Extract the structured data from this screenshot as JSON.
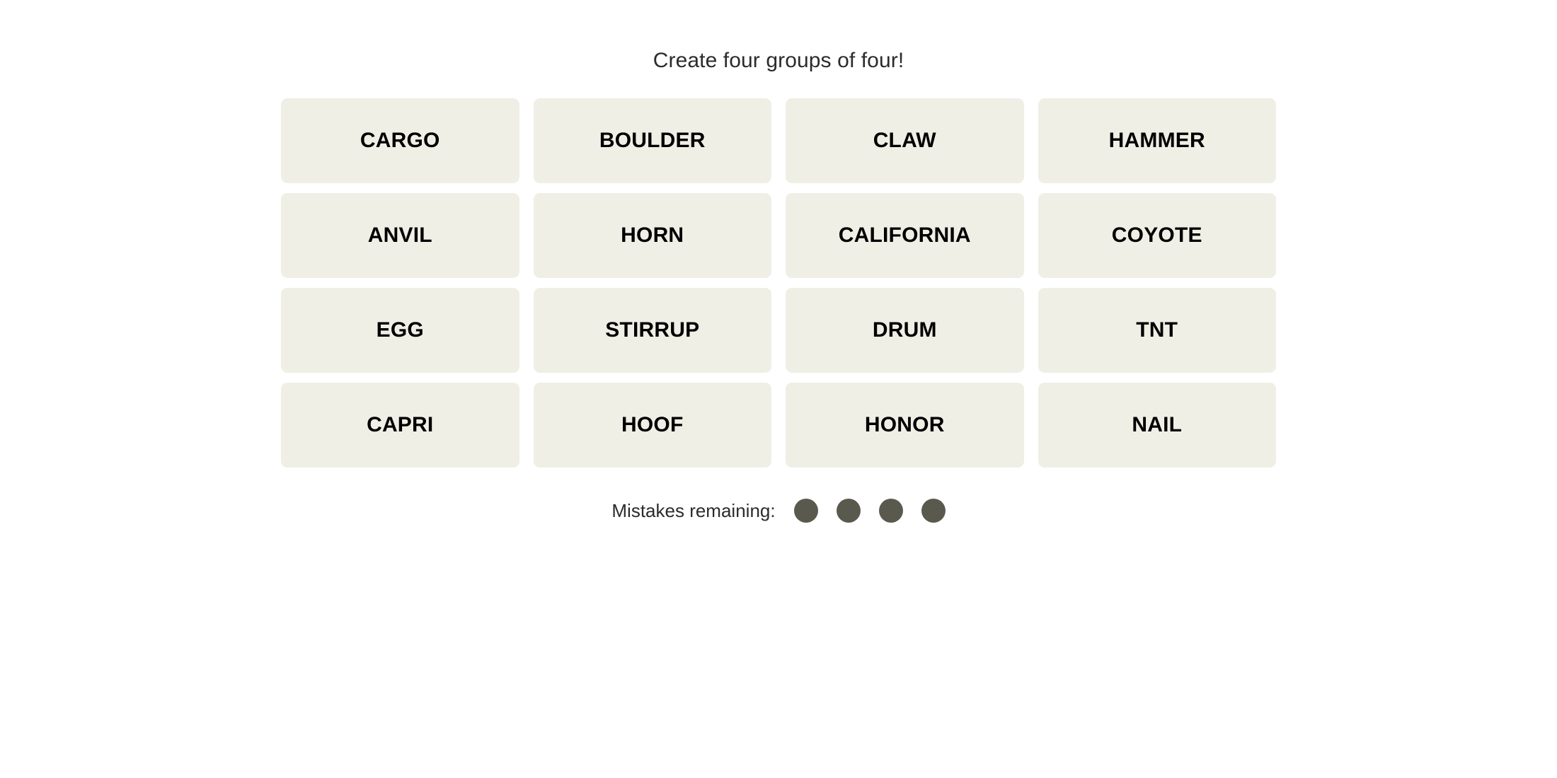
{
  "game": {
    "title": "Create four groups of four!",
    "tile_bg_color": "#EFEFE6",
    "tile_text_color": "#000000",
    "page_bg_color": "#FFFFFF",
    "title_color": "#2B2B2B",
    "mistake_dot_color": "#5A594E",
    "grid": {
      "rows": 4,
      "columns": 4,
      "tiles": [
        {
          "label": "CARGO"
        },
        {
          "label": "BOULDER"
        },
        {
          "label": "CLAW"
        },
        {
          "label": "HAMMER"
        },
        {
          "label": "ANVIL"
        },
        {
          "label": "HORN"
        },
        {
          "label": "CALIFORNIA"
        },
        {
          "label": "COYOTE"
        },
        {
          "label": "EGG"
        },
        {
          "label": "STIRRUP"
        },
        {
          "label": "DRUM"
        },
        {
          "label": "TNT"
        },
        {
          "label": "CAPRI"
        },
        {
          "label": "HOOF"
        },
        {
          "label": "HONOR"
        },
        {
          "label": "NAIL"
        }
      ]
    },
    "mistakes": {
      "label": "Mistakes remaining:",
      "remaining": 4,
      "dots": [
        {
          "name": "mistake-dot-1"
        },
        {
          "name": "mistake-dot-2"
        },
        {
          "name": "mistake-dot-3"
        },
        {
          "name": "mistake-dot-4"
        }
      ]
    }
  }
}
